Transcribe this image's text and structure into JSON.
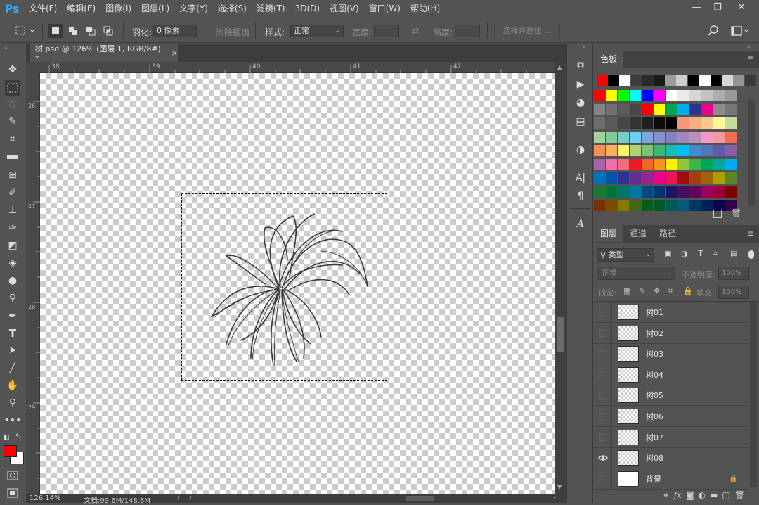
{
  "app": {
    "logo": "Ps"
  },
  "menu": [
    "文件(F)",
    "编辑(E)",
    "图像(I)",
    "图层(L)",
    "文字(Y)",
    "选择(S)",
    "滤镜(T)",
    "3D(D)",
    "视图(V)",
    "窗口(W)",
    "帮助(H)"
  ],
  "window_controls": {
    "minimize": "—",
    "restore": "❐",
    "close": "✕"
  },
  "options": {
    "feather_label": "羽化:",
    "feather_value": "0 像素",
    "antialias_label": "消除锯齿",
    "style_label": "样式:",
    "style_value": "正常",
    "width_label": "宽度:",
    "height_label": "高度:",
    "select_mask_button": "选择并遮住 ..."
  },
  "document": {
    "tab_title": "树.psd @ 126% (图层 1, RGB/8#) *",
    "tab_close": "×",
    "ruler_top_labels": [
      "38",
      "39",
      "40",
      "41",
      "42"
    ],
    "ruler_left_labels": [
      "26",
      "27",
      "28",
      "29"
    ],
    "zoom": "126.14%",
    "doc_info": "文档:99.6M/148.6M"
  },
  "swatches": {
    "tab": "色板",
    "recent": [
      "#ff0000",
      "#000000",
      "#ffffff",
      "#3c3c3c",
      "#2a2a2a",
      "#1a1a1a",
      "#9c9c9c",
      "#cccccc",
      "#000000",
      "#ffffff",
      "#000000",
      "#d7d7d7",
      "#949494",
      "#3a3a3a"
    ],
    "grid": [
      [
        "#ff0000",
        "#ffff00",
        "#00ff00",
        "#00ffff",
        "#0000ff",
        "#ff00ff",
        "#ffffff",
        "#ebebeb",
        "#d6d6d6",
        "#c2c2c2",
        "#adadad",
        "#999999"
      ],
      [
        "#858585",
        "#707070",
        "#5c5c5c",
        "#474747",
        "#ff0000",
        "#ffff00",
        "#00a651",
        "#00aeef",
        "#2e3192",
        "#ec008c",
        "#8c8c8c",
        "#777777"
      ],
      [
        "#6e6e6e",
        "#5a5a5a",
        "#464646",
        "#333333",
        "#1f1f1f",
        "#0d0d0d",
        "#000000",
        "#f7977a",
        "#f9ad81",
        "#fdc68a",
        "#fff79a",
        "#c4df9b"
      ],
      [
        "#a3d39c",
        "#82ca9c",
        "#7accc8",
        "#6dcff6",
        "#7da7d9",
        "#8393ca",
        "#8781bd",
        "#a187be",
        "#bc8dbf",
        "#f49ac2",
        "#f6989d",
        "#f26c4f"
      ],
      [
        "#f68e56",
        "#fbaf5d",
        "#fff568",
        "#acd372",
        "#7cc576",
        "#3bb878",
        "#1abbb4",
        "#00bff3",
        "#438ccb",
        "#5574b9",
        "#605ca8",
        "#855fa8"
      ],
      [
        "#a763a8",
        "#f06ea9",
        "#f26d7d",
        "#ed1c24",
        "#f26522",
        "#f7941d",
        "#fff200",
        "#8dc63f",
        "#39b54a",
        "#00a651",
        "#00a99d",
        "#00aeef"
      ],
      [
        "#0072bc",
        "#0054a6",
        "#2e3192",
        "#662d91",
        "#92278f",
        "#ec008c",
        "#ed145b",
        "#9e0b0f",
        "#a0410d",
        "#a36209",
        "#aba000",
        "#598527"
      ],
      [
        "#197b30",
        "#007236",
        "#00746b",
        "#0076a3",
        "#004a80",
        "#003471",
        "#1b1464",
        "#440e62",
        "#630460",
        "#9e005d",
        "#9e0039",
        "#790000"
      ],
      [
        "#7b2e00",
        "#7d4900",
        "#827b00",
        "#406618",
        "#005e20",
        "#005826",
        "#005952",
        "#005b7f",
        "#003663",
        "#002157",
        "#0d004c",
        "#32004b"
      ]
    ]
  },
  "layers_panel": {
    "tabs": [
      "图层",
      "通道",
      "路径"
    ],
    "filter_label": "类型",
    "blend_mode": "正常",
    "opacity_label": "不透明度:",
    "opacity_value": "100%",
    "lock_label": "锁定:",
    "fill_label": "填充:",
    "fill_value": "100%",
    "layers": [
      {
        "name": "树01",
        "visible": false
      },
      {
        "name": "树02",
        "visible": false
      },
      {
        "name": "树03",
        "visible": false
      },
      {
        "name": "树04",
        "visible": false
      },
      {
        "name": "树05",
        "visible": false
      },
      {
        "name": "树06",
        "visible": false
      },
      {
        "name": "树07",
        "visible": false
      },
      {
        "name": "树08",
        "visible": true
      },
      {
        "name": "背景",
        "visible": false
      }
    ],
    "bottom_fx": "fx"
  }
}
